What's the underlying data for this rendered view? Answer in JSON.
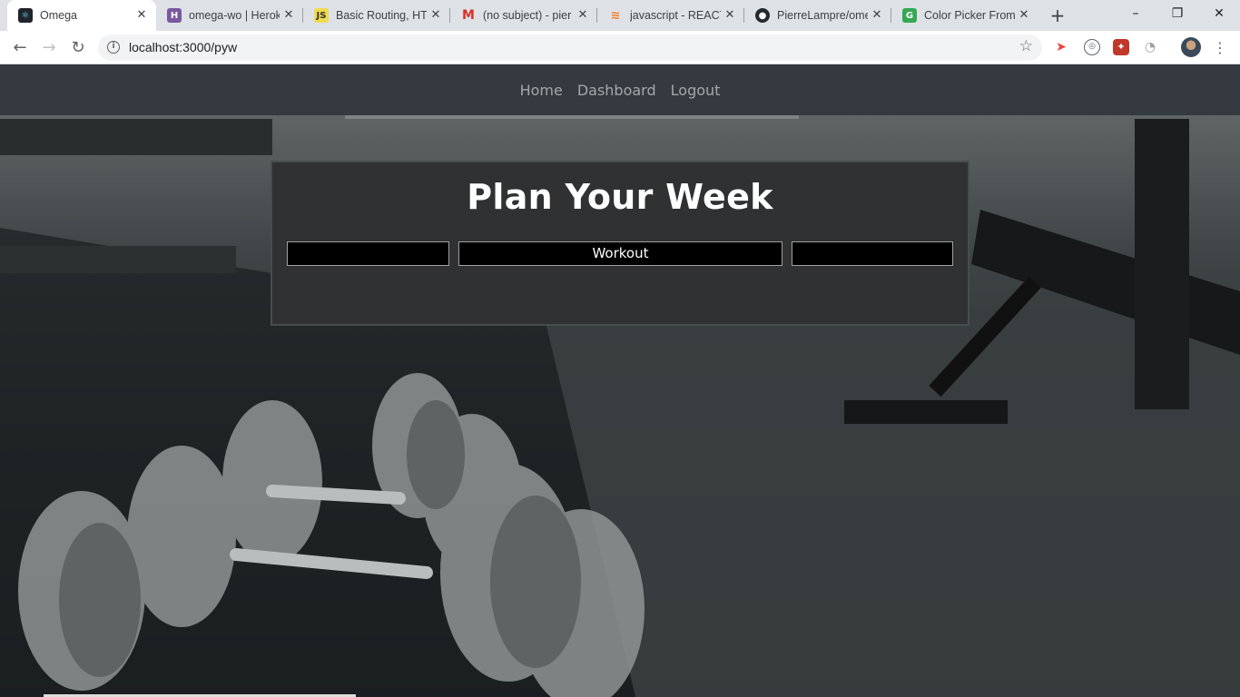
{
  "browser": {
    "tabs": [
      {
        "title": "Omega",
        "favicon": "react-icon",
        "active": true
      },
      {
        "title": "omega-wo | Herok",
        "favicon": "heroku-icon"
      },
      {
        "title": "Basic Routing, HTT",
        "favicon": "js-icon"
      },
      {
        "title": "(no subject) - pier",
        "favicon": "gmail-icon"
      },
      {
        "title": "javascript - REACT",
        "favicon": "stackoverflow-icon"
      },
      {
        "title": "PierreLampre/ome",
        "favicon": "github-icon"
      },
      {
        "title": "Color Picker From",
        "favicon": "color-picker-icon"
      }
    ],
    "url": "localhost:3000/pyw",
    "new_tab_symbol": "+",
    "window_controls": {
      "minimize": "–",
      "restore": "❐",
      "close": "✕"
    }
  },
  "nav": {
    "links": [
      "Home",
      "Dashboard",
      "Logout"
    ]
  },
  "main": {
    "title": "Plan Your Week",
    "columns": [
      "",
      "Workout",
      ""
    ]
  },
  "colors": {
    "navbar_bg": "#343a40",
    "panel_bg": "#2f3132",
    "cell_bg": "#000000"
  }
}
